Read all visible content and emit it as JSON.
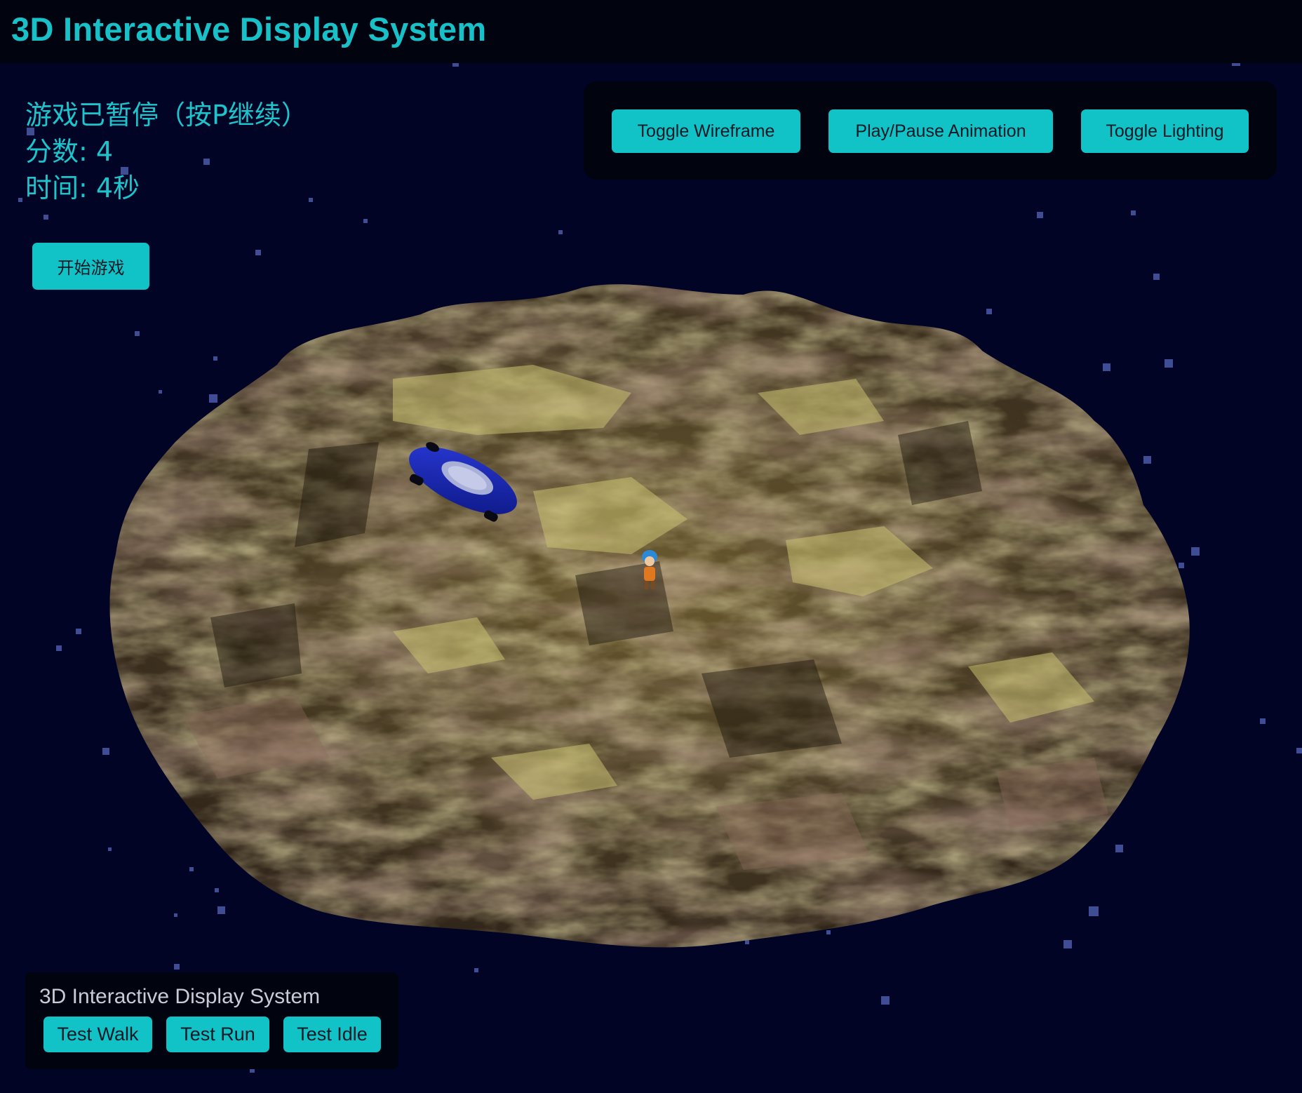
{
  "header": {
    "title": "3D Interactive Display System"
  },
  "hud": {
    "status": "游戏已暂停（按P继续）",
    "score": "分数: 4",
    "time": "时间: 4秒"
  },
  "buttons": {
    "start_game": "开始游戏",
    "toggle_wireframe": "Toggle Wireframe",
    "play_pause": "Play/Pause Animation",
    "toggle_lighting": "Toggle Lighting"
  },
  "animation_panel": {
    "title": "3D Interactive Display System",
    "walk": "Test Walk",
    "run": "Test Run",
    "idle": "Test Idle"
  },
  "colors": {
    "accent": "#11c2c6",
    "background": "#020426",
    "panel": "#01030f",
    "hud_text": "#1cc4cc"
  },
  "scene": {
    "objects": [
      "terrain-island",
      "blue-car",
      "character"
    ]
  }
}
